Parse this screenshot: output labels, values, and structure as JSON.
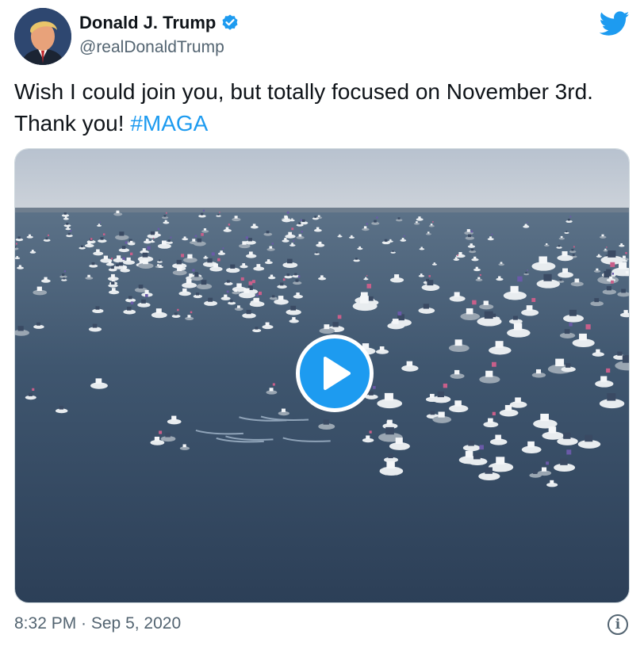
{
  "author": {
    "name": "Donald J. Trump",
    "handle": "@realDonaldTrump",
    "verified": true,
    "avatar_icon": "profile-photo"
  },
  "tweet": {
    "text_before": "Wish I could join you, but totally focused on November 3rd.",
    "text_thanks": "Thank you! ",
    "hashtag": "#MAGA"
  },
  "media": {
    "type": "video",
    "play_icon": "play-icon"
  },
  "footer": {
    "timestamp": "8:32 PM · Sep 5, 2020",
    "info_glyph": "i"
  },
  "colors": {
    "accent": "#1d9bf0",
    "text": "#0f1419",
    "muted": "#536471"
  }
}
